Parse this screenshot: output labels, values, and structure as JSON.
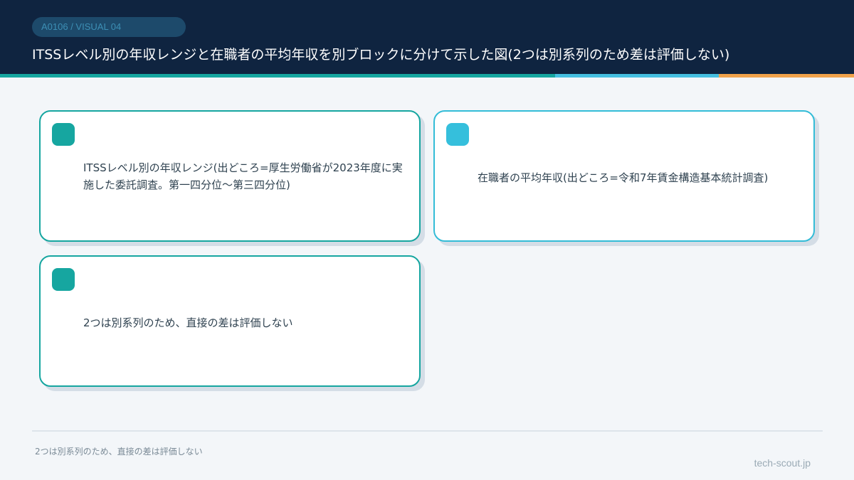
{
  "header": {
    "tag": "A0106 / VISUAL 04",
    "title": "ITSSレベル別の年収レンジと在職者の平均年収を別ブロックに分けて示した図(2つは別系列のため差は評価しない)"
  },
  "colors": {
    "header_bg": "#0f2440",
    "teal": "#16a6a0",
    "sky": "#45bfe0",
    "orange": "#f0a24a"
  },
  "cards": [
    {
      "text": "ITSSレベル別の年収レンジ(出どころ=厚生労働省が2023年度に実施した委託調査。第一四分位〜第三四分位)"
    },
    {
      "text": "在職者の平均年収(出どころ=令和7年賃金構造基本統計調査)"
    },
    {
      "text": "2つは別系列のため、直接の差は評価しない"
    }
  ],
  "footer": {
    "note": "2つは別系列のため、直接の差は評価しない",
    "site": "tech-scout.jp"
  }
}
